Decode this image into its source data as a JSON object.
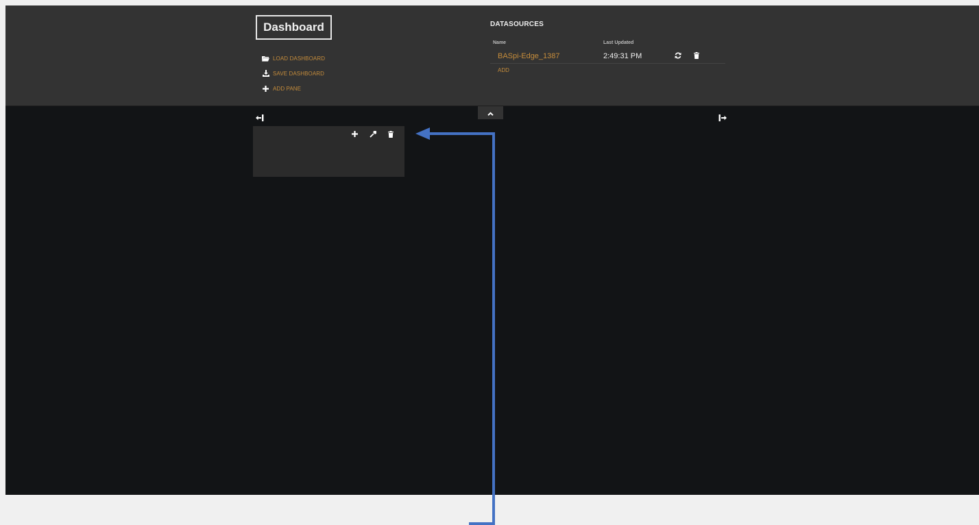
{
  "header": {
    "title": "Dashboard",
    "menu": [
      {
        "label": "LOAD DASHBOARD",
        "icon": "folder-open-icon"
      },
      {
        "label": "SAVE DASHBOARD",
        "icon": "download-icon"
      },
      {
        "label": "ADD PANE",
        "icon": "plus-icon"
      }
    ]
  },
  "datasources": {
    "title": "DATASOURCES",
    "col_name": "Name",
    "col_updated": "Last Updated",
    "rows": [
      {
        "name": "BASpi-Edge_1387",
        "last_updated": "2:49:31 PM"
      }
    ],
    "add_label": "ADD"
  },
  "colors": {
    "accent": "#c58c3b",
    "header_bg": "#333333",
    "board_bg": "#121416",
    "pane_bg": "#2b2b2b",
    "annotation": "#4472c4"
  }
}
